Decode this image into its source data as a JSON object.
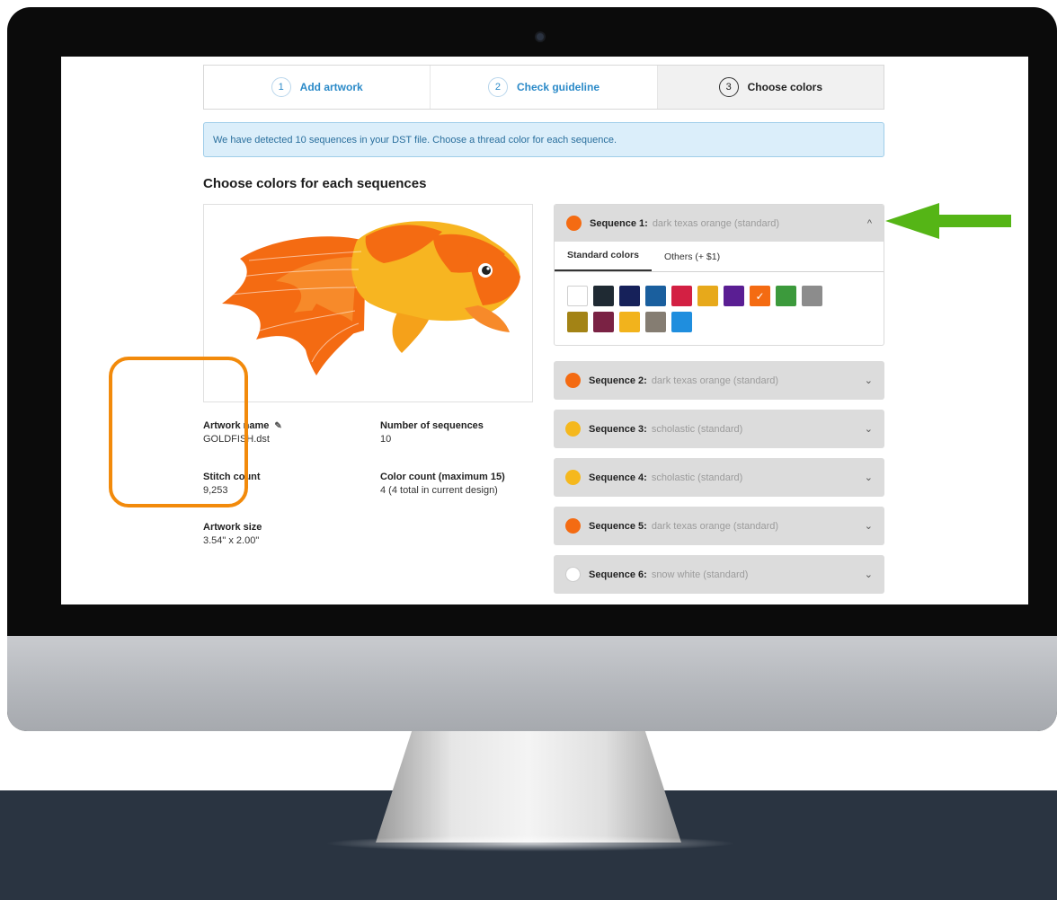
{
  "colors": {
    "accent_blue": "#2b8ac8",
    "orange": "#f46b12",
    "gold": "#f5b81d",
    "white": "#ffffff",
    "highlight_outline": "#f28a0b",
    "arrow_green": "#55b516"
  },
  "steps": [
    {
      "num": "1",
      "label": "Add artwork"
    },
    {
      "num": "2",
      "label": "Check guideline"
    },
    {
      "num": "3",
      "label": "Choose colors"
    }
  ],
  "alert": {
    "text": "We have detected 10 sequences in your DST file. Choose a thread color for each sequence."
  },
  "section_title": "Choose colors for each sequences",
  "info": {
    "artwork_name_label": "Artwork name",
    "artwork_name_value": "GOLDFISH.dst",
    "stitch_count_label": "Stitch count",
    "stitch_count_value": "9,253",
    "artwork_size_label": "Artwork size",
    "artwork_size_value": "3.54\" x 2.00\"",
    "num_sequences_label": "Number of sequences",
    "num_sequences_value": "10",
    "color_count_label": "Color count (maximum 15)",
    "color_count_value": "4 (4 total in current design)"
  },
  "sequences": [
    {
      "name": "Sequence 1:",
      "color": "dark texas orange (standard)",
      "dot": "#f46b12",
      "expanded": true
    },
    {
      "name": "Sequence 2:",
      "color": "dark texas orange (standard)",
      "dot": "#f46b12"
    },
    {
      "name": "Sequence 3:",
      "color": "scholastic (standard)",
      "dot": "#f5b81d"
    },
    {
      "name": "Sequence 4:",
      "color": "scholastic (standard)",
      "dot": "#f5b81d"
    },
    {
      "name": "Sequence 5:",
      "color": "dark texas orange (standard)",
      "dot": "#f46b12"
    },
    {
      "name": "Sequence 6:",
      "color": "snow white (standard)",
      "dot": "#ffffff"
    }
  ],
  "tabs": {
    "standard": "Standard colors",
    "others": "Others (+ $1)"
  },
  "swatches": [
    "#ffffff",
    "#1f2a33",
    "#16215a",
    "#1a5f9e",
    "#d32043",
    "#e7a91b",
    "#5a1e93",
    "#f46b12",
    "#3c9a3c",
    "#8c8c8c",
    "#a38315",
    "#7a2244",
    "#f2b31c",
    "#857d72",
    "#1f8ede"
  ],
  "selected_swatch": "#f46b12"
}
